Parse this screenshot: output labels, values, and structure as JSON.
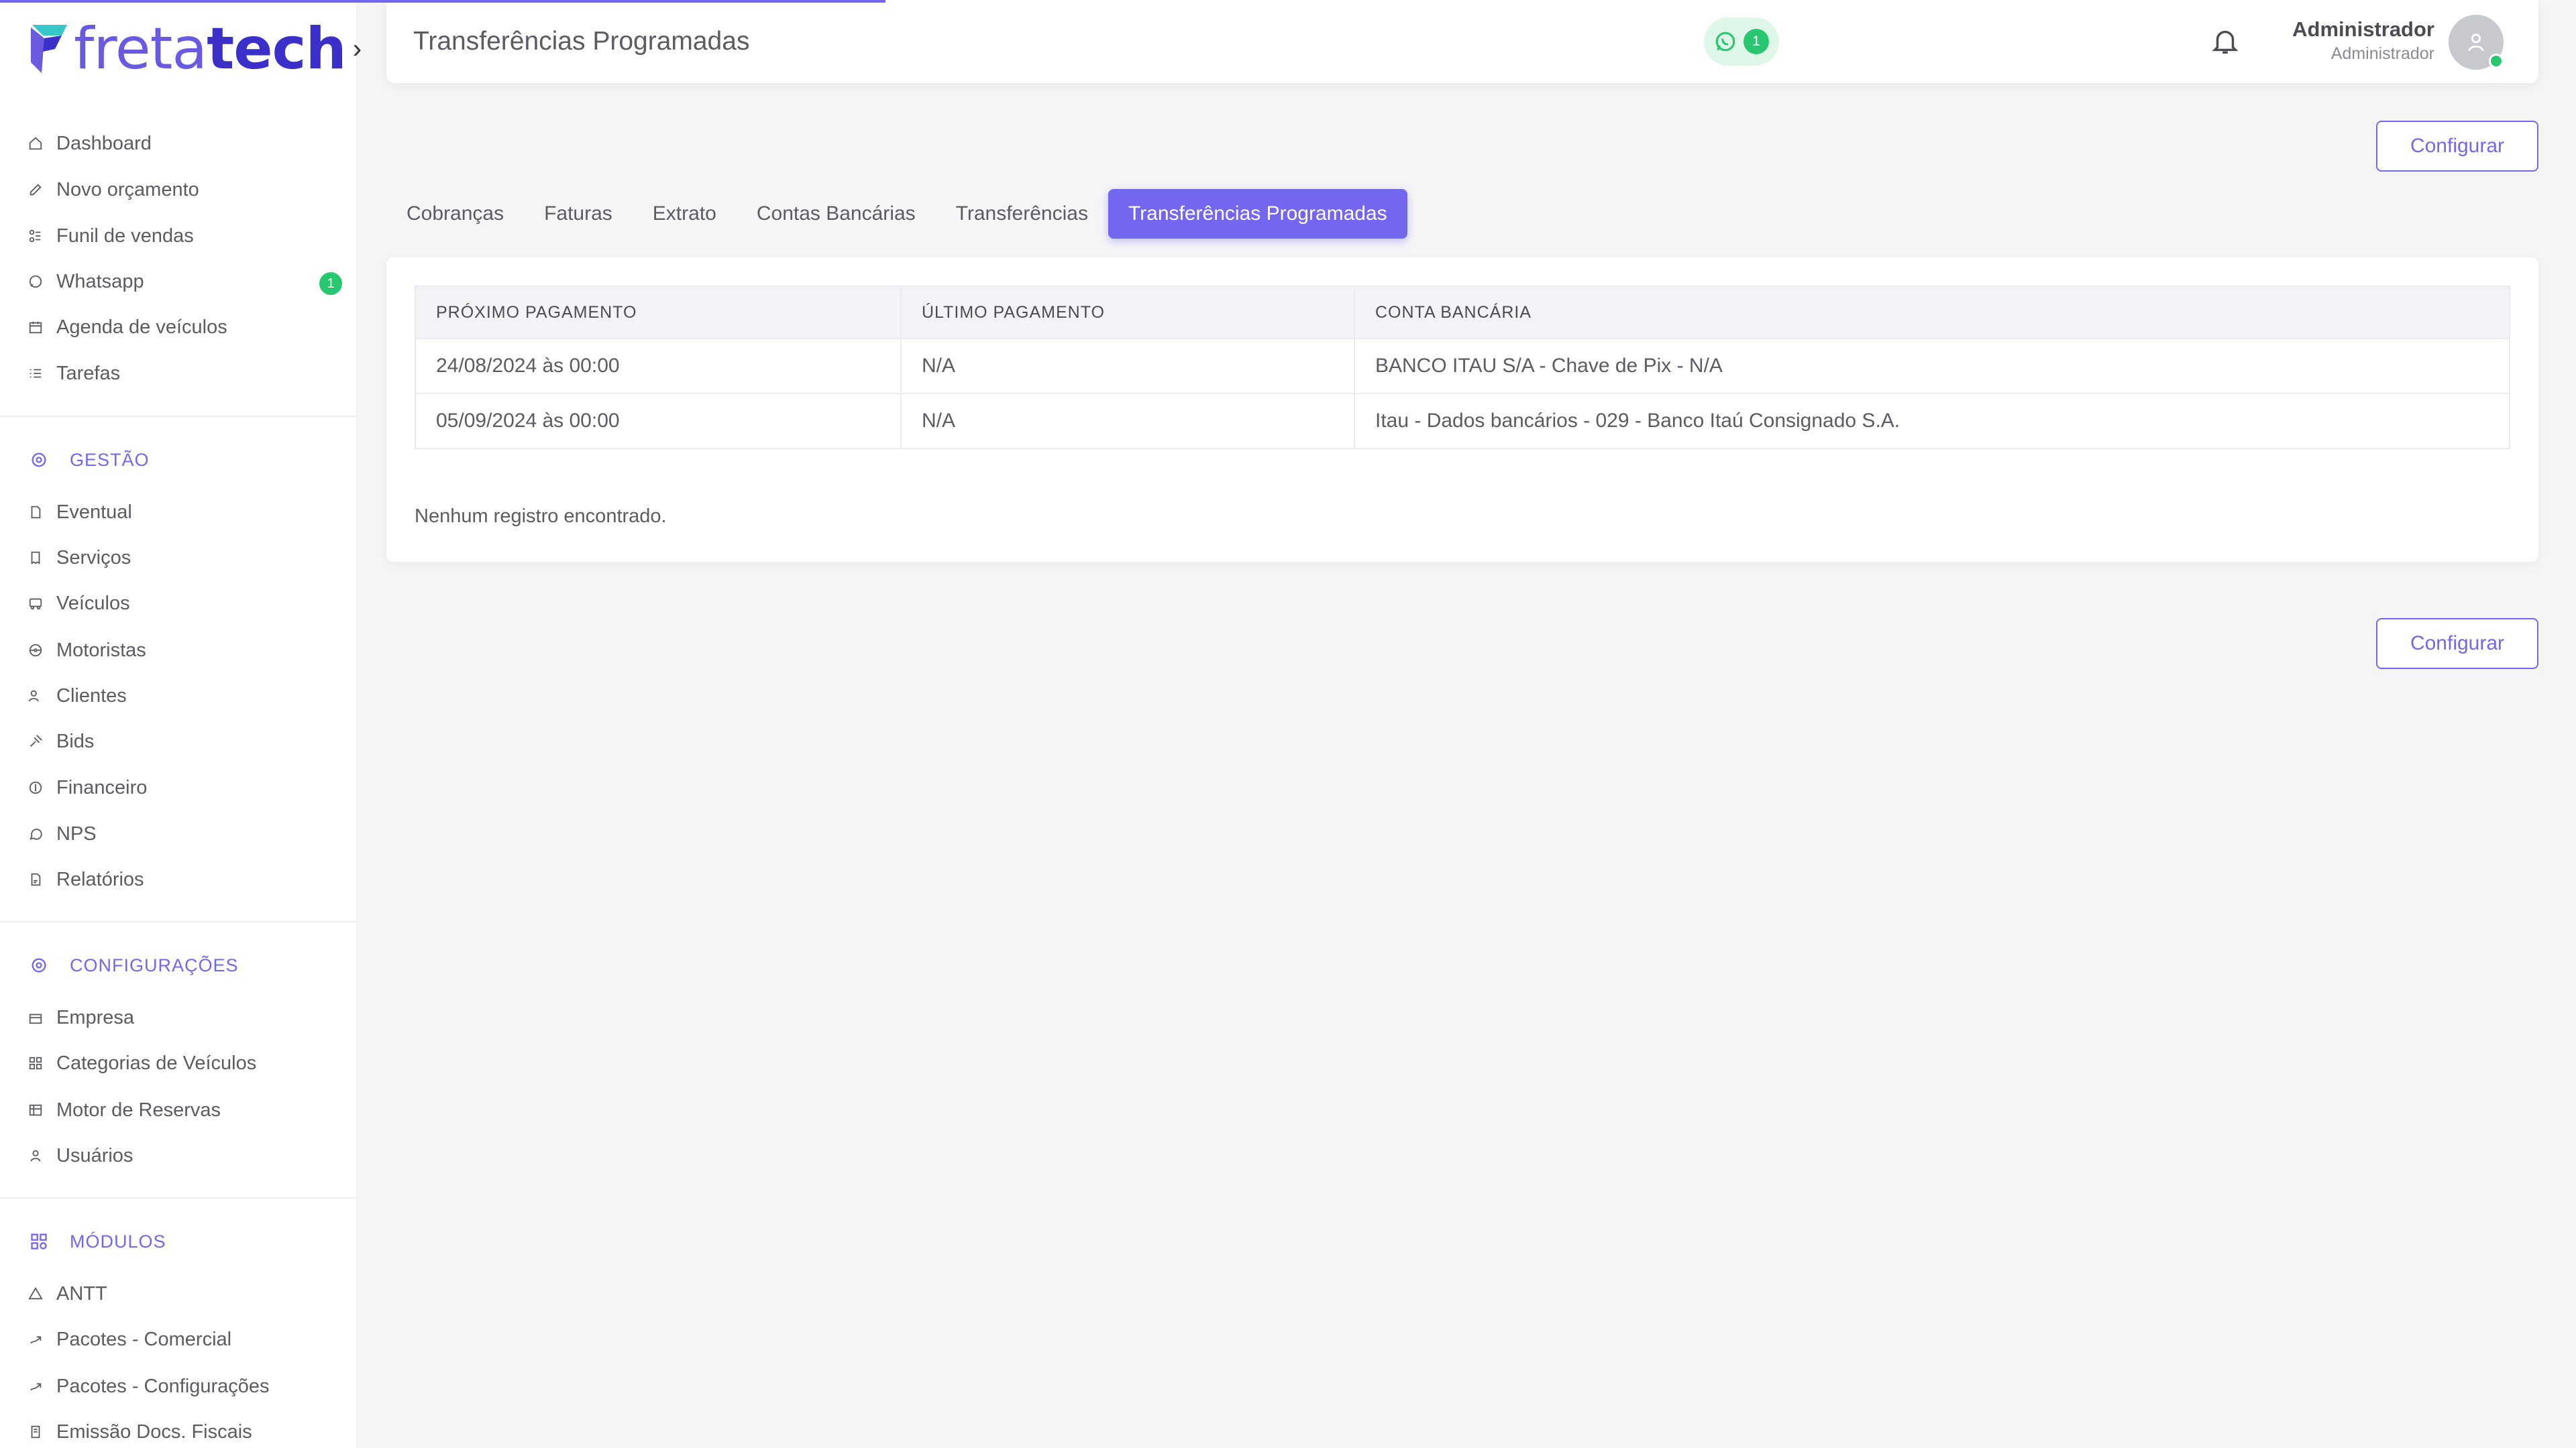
{
  "app": {
    "logo_text_thin": "freta",
    "logo_text_bold": "tech",
    "accent_color": "#7367f0",
    "success_color": "#28c76f"
  },
  "sidebar": {
    "main_items": [
      {
        "label": "Dashboard",
        "icon": "home-icon"
      },
      {
        "label": "Novo orçamento",
        "icon": "edit-icon"
      },
      {
        "label": "Funil de vendas",
        "icon": "funnel-icon"
      },
      {
        "label": "Whatsapp",
        "icon": "whatsapp-icon",
        "badge": "1"
      },
      {
        "label": "Agenda de veículos",
        "icon": "calendar-icon"
      },
      {
        "label": "Tarefas",
        "icon": "list-icon"
      }
    ],
    "gestao_title": "GESTÃO",
    "gestao_items": [
      {
        "label": "Eventual",
        "icon": "file-icon"
      },
      {
        "label": "Serviços",
        "icon": "receipt-icon"
      },
      {
        "label": "Veículos",
        "icon": "bus-icon"
      },
      {
        "label": "Motoristas",
        "icon": "steering-wheel-icon"
      },
      {
        "label": "Clientes",
        "icon": "users-icon"
      },
      {
        "label": "Bids",
        "icon": "gavel-icon"
      },
      {
        "label": "Financeiro",
        "icon": "coin-icon"
      },
      {
        "label": "NPS",
        "icon": "message-circle-icon"
      },
      {
        "label": "Relatórios",
        "icon": "report-icon"
      }
    ],
    "config_title": "CONFIGURAÇÕES",
    "config_items": [
      {
        "label": "Empresa",
        "icon": "building-icon"
      },
      {
        "label": "Categorias de Veículos",
        "icon": "category-icon"
      },
      {
        "label": "Motor de Reservas",
        "icon": "table-icon"
      },
      {
        "label": "Usuários",
        "icon": "user-icon"
      }
    ],
    "modulos_title": "MÓDULOS",
    "modulos_items": [
      {
        "label": "ANTT",
        "icon": "triangle-icon"
      },
      {
        "label": "Pacotes - Comercial",
        "icon": "package-icon"
      },
      {
        "label": "Pacotes - Configurações",
        "icon": "package-icon"
      },
      {
        "label": "Emissão Docs. Fiscais",
        "icon": "document-icon"
      }
    ]
  },
  "header": {
    "title": "Transferências Programadas",
    "whatsapp_count": "1",
    "user_name": "Administrador",
    "user_role": "Administrador"
  },
  "actions": {
    "configure_top": "Configurar",
    "configure_bottom": "Configurar"
  },
  "tabs": [
    {
      "label": "Cobranças",
      "active": false
    },
    {
      "label": "Faturas",
      "active": false
    },
    {
      "label": "Extrato",
      "active": false
    },
    {
      "label": "Contas Bancárias",
      "active": false
    },
    {
      "label": "Transferências",
      "active": false
    },
    {
      "label": "Transferências Programadas",
      "active": true
    }
  ],
  "table": {
    "headers": [
      "Próximo Pagamento",
      "Último Pagamento",
      "Conta Bancária"
    ],
    "rows": [
      [
        "24/08/2024 às 00:00",
        "N/A",
        "BANCO ITAU S/A - Chave de Pix - N/A"
      ],
      [
        "05/09/2024 às 00:00",
        "N/A",
        "Itau - Dados bancários - 029 - Banco Itaú Consignado S.A."
      ]
    ],
    "empty_message": "Nenhum registro encontrado."
  }
}
